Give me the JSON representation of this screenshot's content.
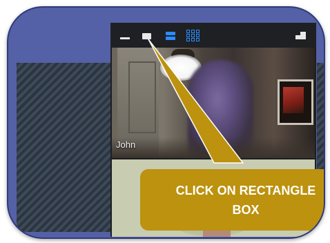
{
  "toolbar": {
    "buttons": [
      {
        "name": "minimize",
        "icon": "minimize-icon"
      },
      {
        "name": "normal-window",
        "icon": "rectangle-icon"
      },
      {
        "name": "speaker-view",
        "icon": "speaker-view-icon",
        "active": true
      },
      {
        "name": "gallery-view",
        "icon": "gallery-view-icon"
      },
      {
        "name": "exit-fullscreen",
        "icon": "window-icon"
      }
    ],
    "active_color": "#2a8cff"
  },
  "participants": [
    {
      "name": "John"
    },
    {
      "name": ""
    }
  ],
  "callout": {
    "line1": "CLICK ON RECTANGLE",
    "line2": "BOX",
    "color": "#bc920e"
  },
  "colors": {
    "frame": "#5461a6",
    "panel": "#1e1f22"
  }
}
